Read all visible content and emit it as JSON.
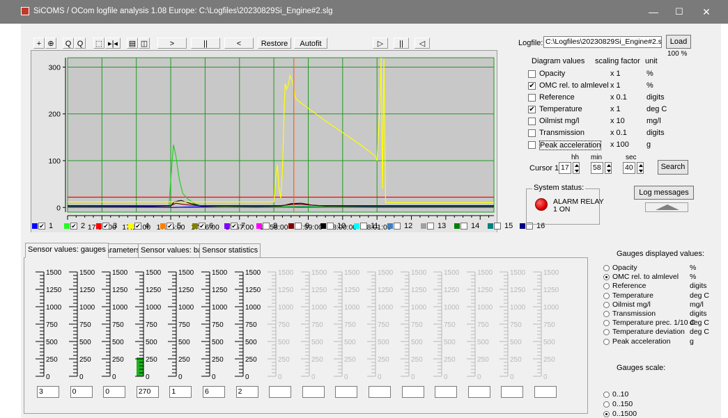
{
  "window": {
    "title": "SiCOMS / OCom logfile analysis 1.08 Europe: C:\\Logfiles\\20230829Si_Engine#2.slg",
    "minimize": "—",
    "maximize": "☐",
    "close": "✕"
  },
  "toolbar": {
    "pan": "+",
    "zoom_region": "⊕",
    "zoom_out": "Q",
    "zoom_in": "Q",
    "select": "⬚",
    "fit": "▸|◂",
    "print": "▤",
    "preview": "◫",
    "play_fwd": ">",
    "pause": "||",
    "play_back": "<",
    "restore": "Restore",
    "autofit": "Autofit",
    "play_fwd2": "▷",
    "pause2": "||",
    "play_back2": "◁"
  },
  "chart_data": {
    "type": "line",
    "ylim": [
      -10,
      320
    ],
    "yticks": [
      0,
      100,
      200,
      300
    ],
    "x_minutes": [
      0,
      12.4
    ],
    "xticks": [
      "17:53:00",
      "17:54:00",
      "17:55:00",
      "17:56:00",
      "17:57:00",
      "17:58:00",
      "17:59:00",
      "18:00:00",
      "18:01:00"
    ],
    "xtick_positions_min": [
      1,
      2,
      3,
      4,
      5,
      6,
      7,
      8,
      9
    ],
    "cursor_min": 6.58,
    "grid": true,
    "background": "#c8c8c8",
    "grid_color": "#1e9a1e",
    "series": [
      {
        "color": "#ff0000",
        "points": [
          [
            0,
            22
          ],
          [
            12.4,
            22
          ]
        ]
      },
      {
        "color": "#0000ff",
        "points": [
          [
            0,
            1
          ],
          [
            2.5,
            1
          ],
          [
            3.0,
            0
          ],
          [
            3.5,
            1
          ],
          [
            4.5,
            2
          ],
          [
            5.5,
            1
          ],
          [
            6.2,
            2
          ],
          [
            6.8,
            1
          ],
          [
            7.5,
            2
          ],
          [
            9,
            1
          ],
          [
            12.4,
            1
          ]
        ]
      },
      {
        "color": "#20d020",
        "points": [
          [
            0,
            2
          ],
          [
            2.95,
            3
          ],
          [
            3.0,
            60
          ],
          [
            3.08,
            134
          ],
          [
            3.15,
            110
          ],
          [
            3.25,
            60
          ],
          [
            3.35,
            30
          ],
          [
            3.5,
            18
          ],
          [
            3.7,
            8
          ],
          [
            3.9,
            3
          ],
          [
            4.5,
            2
          ],
          [
            12.4,
            2
          ]
        ]
      },
      {
        "color": "#000000",
        "points": [
          [
            0,
            3
          ],
          [
            3.0,
            3
          ],
          [
            3.1,
            12
          ],
          [
            3.3,
            15
          ],
          [
            3.6,
            8
          ],
          [
            3.9,
            3
          ],
          [
            6.2,
            3
          ],
          [
            6.5,
            8
          ],
          [
            6.8,
            9
          ],
          [
            7.1,
            5
          ],
          [
            7.5,
            3
          ],
          [
            12.4,
            3
          ]
        ]
      },
      {
        "color": "#800000",
        "points": [
          [
            0,
            4
          ],
          [
            3.0,
            4
          ],
          [
            3.15,
            9
          ],
          [
            3.4,
            6
          ],
          [
            3.8,
            4
          ],
          [
            6.2,
            4
          ],
          [
            6.6,
            7
          ],
          [
            6.9,
            6
          ],
          [
            7.3,
            4
          ],
          [
            12.4,
            4
          ]
        ]
      },
      {
        "color": "#ffff00",
        "points": [
          [
            0,
            12
          ],
          [
            6.0,
            12
          ],
          [
            6.05,
            60
          ],
          [
            6.1,
            92
          ],
          [
            6.15,
            40
          ],
          [
            6.2,
            20
          ],
          [
            6.25,
            80
          ],
          [
            6.3,
            210
          ],
          [
            6.33,
            265
          ],
          [
            6.37,
            252
          ],
          [
            6.42,
            262
          ],
          [
            6.47,
            282
          ],
          [
            6.55,
            268
          ],
          [
            6.62,
            235
          ],
          [
            6.7,
            228
          ],
          [
            7.0,
            212
          ],
          [
            7.5,
            185
          ],
          [
            8.0,
            160
          ],
          [
            8.5,
            135
          ],
          [
            8.95,
            110
          ],
          [
            9.0,
            100
          ],
          [
            9.08,
            210
          ],
          [
            9.12,
            320
          ],
          [
            9.16,
            40
          ],
          [
            9.2,
            318
          ],
          [
            9.25,
            10
          ],
          [
            12.4,
            10
          ]
        ]
      }
    ]
  },
  "right_panel": {
    "logfile_label": "Logfile:",
    "logfile_value": "C:\\Logfiles\\20230829Si_Engine#2.slg",
    "load_button": "Load",
    "percent": "100 %",
    "hdr_values": "Diagram values",
    "hdr_scaling": "scaling factor",
    "hdr_unit": "unit",
    "diagram_rows": [
      {
        "checked": false,
        "label": "Opacity",
        "scale": "x 1",
        "unit": "%"
      },
      {
        "checked": true,
        "label": "OMC rel. to almlevel",
        "scale": "x 1",
        "unit": "%"
      },
      {
        "checked": false,
        "label": "Reference",
        "scale": "x 0.1",
        "unit": "digits"
      },
      {
        "checked": true,
        "label": "Temperature",
        "scale": "x 1",
        "unit": "deg C"
      },
      {
        "checked": false,
        "label": "Oilmist mg/l",
        "scale": "x 10",
        "unit": "mg/l"
      },
      {
        "checked": false,
        "label": "Transmission",
        "scale": "x 0.1",
        "unit": "digits"
      },
      {
        "checked": false,
        "label": "Peak acceleration",
        "scale": "x 100",
        "unit": "g"
      }
    ],
    "cursor_label": "Cursor 1:",
    "hh_label": "hh",
    "min_label": "min",
    "sec_label": "sec",
    "hh_value": "17",
    "min_value": "58",
    "sec_value": "40",
    "search_button": "Search",
    "system_status_label": "System status:",
    "alarm_text_1": "ALARM RELAY",
    "alarm_text_2": "1 ON",
    "alarm_color": "#ff0000",
    "log_messages_button": "Log messages"
  },
  "legend": [
    {
      "n": "1",
      "color": "#0000ff",
      "checked": true
    },
    {
      "n": "2",
      "color": "#20ff20",
      "checked": true
    },
    {
      "n": "3",
      "color": "#ff0000",
      "checked": true
    },
    {
      "n": "4",
      "color": "#ffff00",
      "checked": true
    },
    {
      "n": "5",
      "color": "#ff8000",
      "checked": true
    },
    {
      "n": "6",
      "color": "#808000",
      "checked": true
    },
    {
      "n": "7",
      "color": "#8000ff",
      "checked": true
    },
    {
      "n": "8",
      "color": "#ff00ff",
      "checked": false
    },
    {
      "n": "9",
      "color": "#800000",
      "checked": false
    },
    {
      "n": "10",
      "color": "#000000",
      "checked": false
    },
    {
      "n": "11",
      "color": "#00ffff",
      "checked": false
    },
    {
      "n": "12",
      "color": "#4080c0",
      "checked": false
    },
    {
      "n": "13",
      "color": "#a0a0a0",
      "checked": false
    },
    {
      "n": "14",
      "color": "#008000",
      "checked": false
    },
    {
      "n": "15",
      "color": "#008080",
      "checked": false
    },
    {
      "n": "16",
      "color": "#000080",
      "checked": false
    }
  ],
  "tabs": [
    "Sensor values: gauges",
    "Parameters",
    "Sensor values: bars",
    "Sensor statistics"
  ],
  "gauges": {
    "scale_labels": [
      "1500",
      "1250",
      "1000",
      "750",
      "500",
      "250",
      "0"
    ],
    "max": 1500,
    "fill_color": "#1db31d",
    "items": [
      {
        "value": "3",
        "active": true,
        "level": 3
      },
      {
        "value": "0",
        "active": true,
        "level": 0
      },
      {
        "value": "0",
        "active": true,
        "level": 0
      },
      {
        "value": "270",
        "active": true,
        "level": 270
      },
      {
        "value": "1",
        "active": true,
        "level": 1
      },
      {
        "value": "6",
        "active": true,
        "level": 6
      },
      {
        "value": "2",
        "active": true,
        "level": 2
      },
      {
        "value": "",
        "active": false,
        "level": 0
      },
      {
        "value": "",
        "active": false,
        "level": 0
      },
      {
        "value": "",
        "active": false,
        "level": 0
      },
      {
        "value": "",
        "active": false,
        "level": 0
      },
      {
        "value": "",
        "active": false,
        "level": 0
      },
      {
        "value": "",
        "active": false,
        "level": 0
      },
      {
        "value": "",
        "active": false,
        "level": 0
      },
      {
        "value": "",
        "active": false,
        "level": 0
      },
      {
        "value": "",
        "active": false,
        "level": 0
      }
    ]
  },
  "gauges_displayed": {
    "title": "Gauges displayed values:",
    "options": [
      {
        "label": "Opacity",
        "unit": "%",
        "selected": false
      },
      {
        "label": "OMC rel. to almlevel",
        "unit": "%",
        "selected": true
      },
      {
        "label": "Reference",
        "unit": "digits",
        "selected": false
      },
      {
        "label": "Temperature",
        "unit": "deg C",
        "selected": false
      },
      {
        "label": "Oilmist mg/l",
        "unit": "mg/l",
        "selected": false
      },
      {
        "label": "Transmission",
        "unit": "digits",
        "selected": false
      },
      {
        "label": "Temperature prec. 1/10 C",
        "unit": "deg C",
        "selected": false
      },
      {
        "label": "Temperature deviation",
        "unit": "deg C",
        "selected": false
      },
      {
        "label": "Peak acceleration",
        "unit": "g",
        "selected": false
      }
    ],
    "scale_title": "Gauges scale:",
    "scales": [
      {
        "label": "0..10",
        "selected": false
      },
      {
        "label": "0..150",
        "selected": false
      },
      {
        "label": "0..1500",
        "selected": true
      }
    ]
  }
}
